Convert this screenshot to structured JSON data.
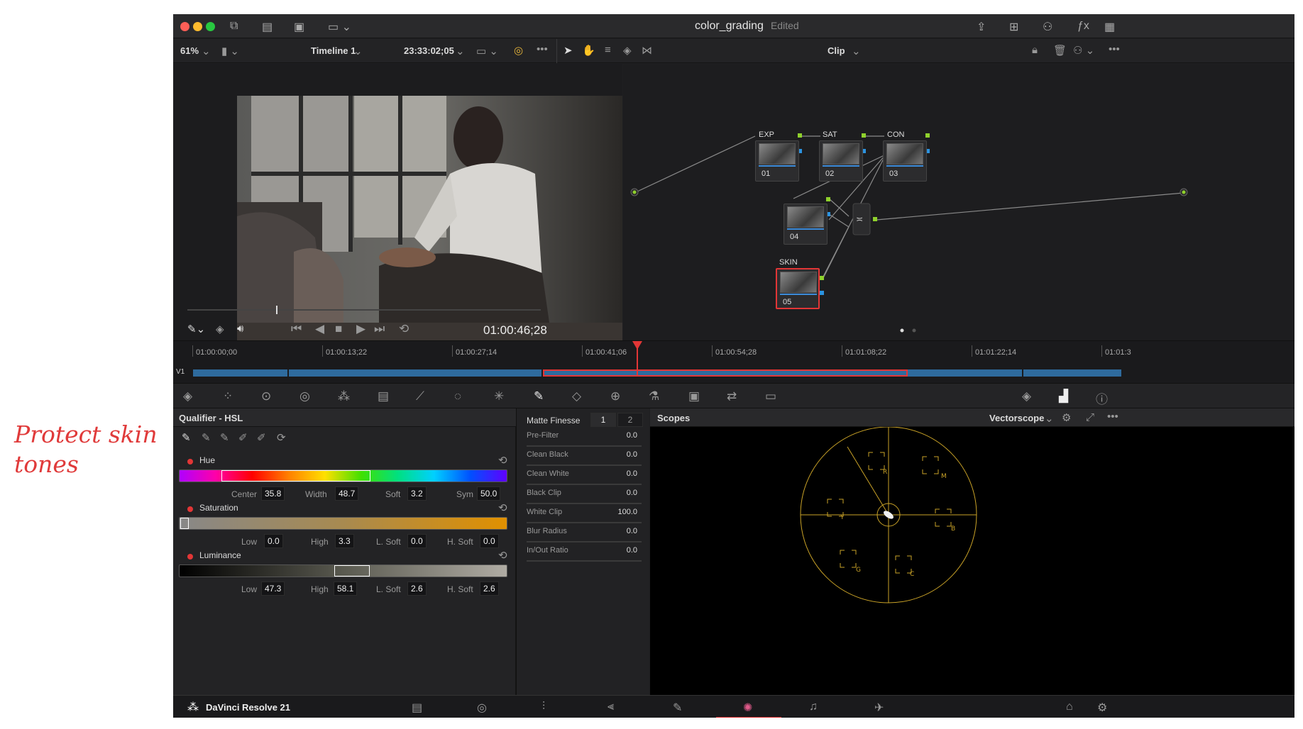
{
  "annotation": "Protect skin tones",
  "window": {
    "title": "color_grading",
    "status": "Edited"
  },
  "viewer_bar": {
    "zoom": "61%",
    "timeline": "Timeline 1",
    "timecode": "23:33:02;05",
    "mode": "Clip"
  },
  "viewer": {
    "timecode": "01:00:46;28"
  },
  "nodes": [
    {
      "label": "EXP",
      "num": "01"
    },
    {
      "label": "SAT",
      "num": "02"
    },
    {
      "label": "CON",
      "num": "03"
    },
    {
      "label": "",
      "num": "04"
    },
    {
      "label": "SKIN",
      "num": "05"
    }
  ],
  "timeline": {
    "track": "V1",
    "timecodes": [
      "01:00:00;00",
      "01:00:13;22",
      "01:00:27;14",
      "01:00:41;06",
      "01:00:54;28",
      "01:01:08;22",
      "01:01:22;14",
      "01:01:3"
    ]
  },
  "qualifier": {
    "title": "Qualifier - HSL",
    "hue": {
      "label": "Hue",
      "center_label": "Center",
      "center": "35.8",
      "width_label": "Width",
      "width": "48.7",
      "soft_label": "Soft",
      "soft": "3.2",
      "sym_label": "Sym",
      "sym": "50.0"
    },
    "saturation": {
      "label": "Saturation",
      "low_label": "Low",
      "low": "0.0",
      "high_label": "High",
      "high": "3.3",
      "lsoft_label": "L. Soft",
      "lsoft": "0.0",
      "hsoft_label": "H. Soft",
      "hsoft": "0.0"
    },
    "luminance": {
      "label": "Luminance",
      "low_label": "Low",
      "low": "47.3",
      "high_label": "High",
      "high": "58.1",
      "lsoft_label": "L. Soft",
      "lsoft": "2.6",
      "hsoft_label": "H. Soft",
      "hsoft": "2.6"
    }
  },
  "matte": {
    "title": "Matte Finesse",
    "tab1": "1",
    "tab2": "2",
    "rows": [
      {
        "label": "Pre-Filter",
        "value": "0.0"
      },
      {
        "label": "Clean Black",
        "value": "0.0"
      },
      {
        "label": "Clean White",
        "value": "0.0"
      },
      {
        "label": "Black Clip",
        "value": "0.0"
      },
      {
        "label": "White Clip",
        "value": "100.0"
      },
      {
        "label": "Blur Radius",
        "value": "0.0"
      },
      {
        "label": "In/Out Ratio",
        "value": "0.0"
      }
    ]
  },
  "scopes": {
    "title": "Scopes",
    "mode": "Vectorscope",
    "targets": [
      "R",
      "M",
      "B",
      "C",
      "G",
      "Y"
    ]
  },
  "footer": {
    "app": "DaVinci Resolve 21"
  },
  "colors": {
    "accent": "#e23636",
    "clip": "#2e6b9e",
    "scope": "#c9a227"
  }
}
